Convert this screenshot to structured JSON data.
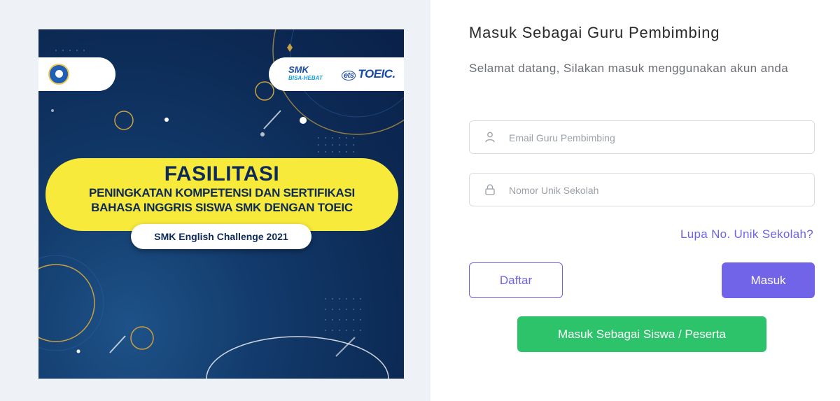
{
  "promo": {
    "logo_smk": "SMK",
    "logo_smk_sub": "BISA-HEBAT",
    "logo_ets": "ets",
    "logo_toeic": "TOEIC.",
    "headline": "FASILITASI",
    "subline_1": "PENINGKATAN KOMPETENSI DAN SERTIFIKASI",
    "subline_2": "BAHASA INGGRIS SISWA SMK DENGAN TOEIC",
    "challenge": "SMK English Challenge 2021",
    "colors": {
      "background": "#0c2a55",
      "banner": "#f7ea3a",
      "text": "#0e2a5a"
    }
  },
  "form": {
    "title": "Masuk Sebagai Guru Pembimbing",
    "subtitle": "Selamat datang, Silakan masuk menggunakan akun anda",
    "email": {
      "placeholder": "Email Guru Pembimbing",
      "value": "",
      "icon": "user-icon"
    },
    "code": {
      "placeholder": "Nomor Unik Sekolah",
      "value": "",
      "icon": "lock-icon"
    },
    "forgot_label": "Lupa No. Unik Sekolah?",
    "register_label": "Daftar",
    "login_label": "Masuk",
    "student_login_label": "Masuk Sebagai Siswa / Peserta"
  },
  "colors": {
    "primary": "#7164e8",
    "success": "#2dc36a",
    "link": "#6d63e6"
  }
}
